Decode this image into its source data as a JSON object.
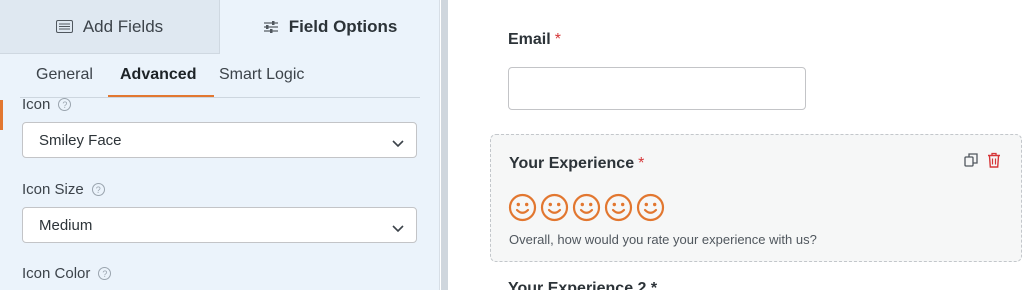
{
  "panel": {
    "tabs": [
      {
        "label": "Add Fields",
        "icon": "list-icon",
        "active": false
      },
      {
        "label": "Field Options",
        "icon": "sliders-icon",
        "active": true
      }
    ],
    "sub_tabs": [
      "General",
      "Advanced",
      "Smart Logic"
    ],
    "active_sub_tab": "Advanced",
    "fields": {
      "icon": {
        "label": "Icon",
        "value": "Smiley Face"
      },
      "icon_size": {
        "label": "Icon Size",
        "value": "Medium"
      },
      "icon_color": {
        "label": "Icon Color"
      }
    }
  },
  "preview": {
    "email": {
      "label": "Email",
      "required_mark": "*",
      "value": ""
    },
    "rating": {
      "label": "Your Experience",
      "required_mark": "*",
      "icon_count": 5,
      "icon": "smiley-icon",
      "description": "Overall, how would you rate your experience with us?"
    },
    "next_field_label": "Your Experience 2 *"
  },
  "colors": {
    "accent": "#e27730",
    "required": "#d63638",
    "delete": "#d63638"
  }
}
